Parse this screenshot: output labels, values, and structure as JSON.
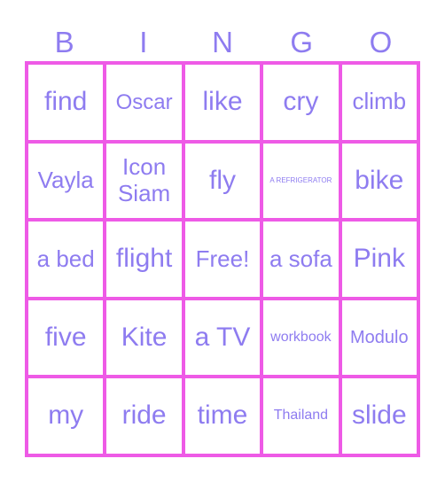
{
  "header": [
    "B",
    "I",
    "N",
    "G",
    "O"
  ],
  "colors": {
    "border": "#ee5ae6",
    "text": "#8e7cf0",
    "background": "#ffffff"
  },
  "cells": [
    [
      "find",
      "Oscar",
      "like",
      "cry",
      "climb"
    ],
    [
      "Vayla",
      "Icon Siam",
      "fly",
      "A REFRIGERATOR",
      "bike"
    ],
    [
      "a bed",
      "flight",
      "Free!",
      "a sofa",
      "Pink"
    ],
    [
      "five",
      "Kite",
      "a TV",
      "workbook",
      "Modulo"
    ],
    [
      "my",
      "ride",
      "time",
      "Thailand",
      "slide"
    ]
  ]
}
